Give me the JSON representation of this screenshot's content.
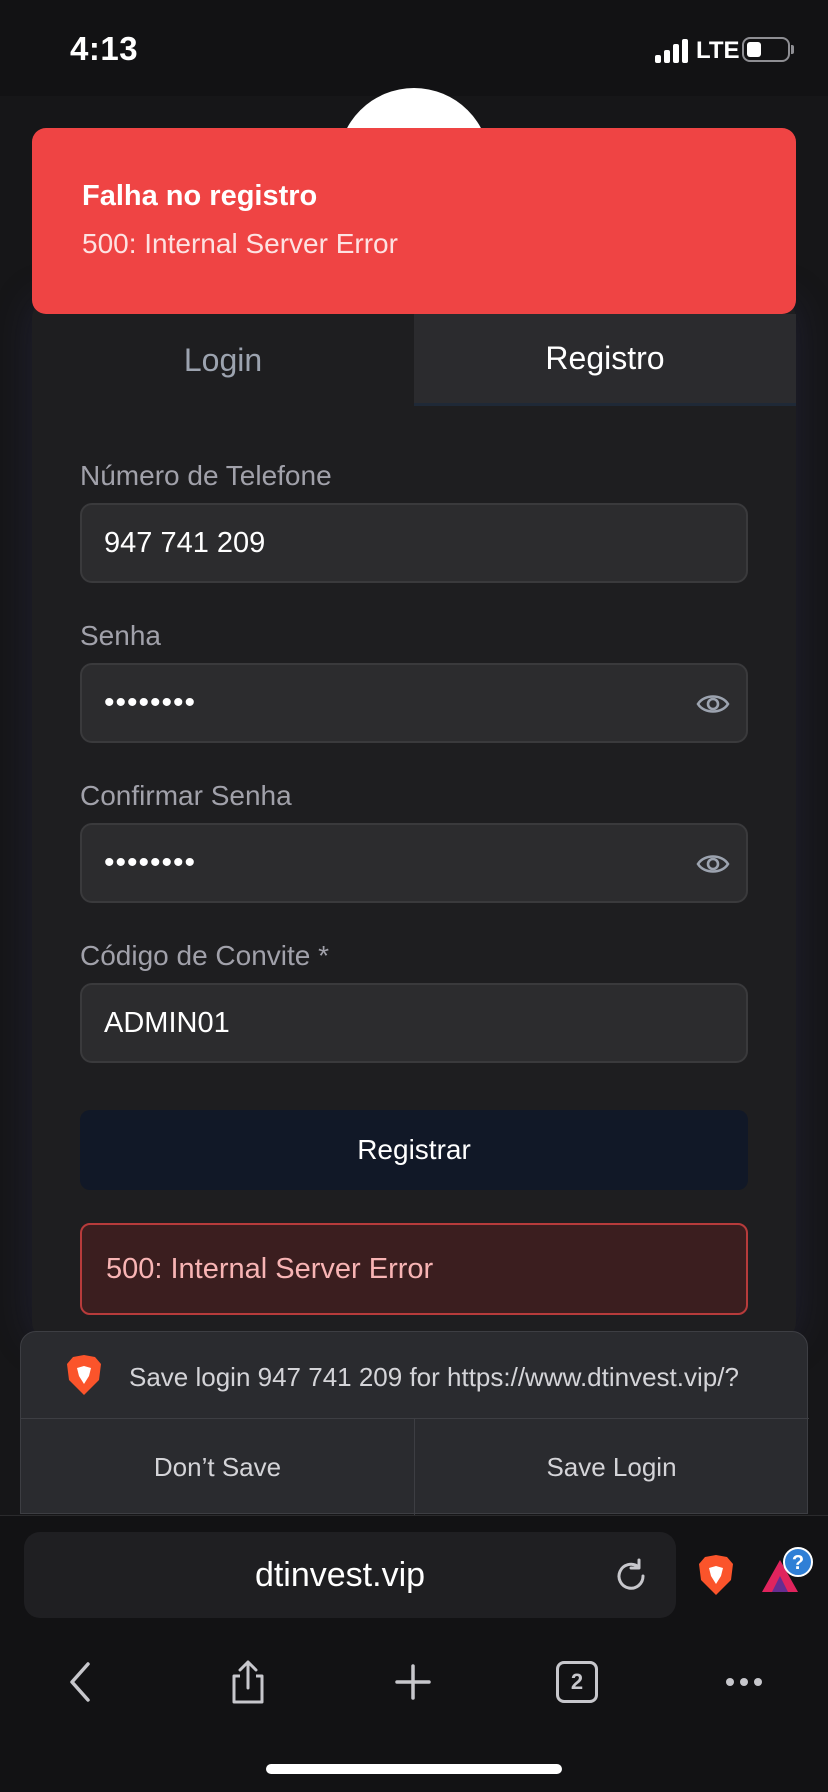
{
  "status_bar": {
    "time": "4:13",
    "network": "LTE"
  },
  "toast": {
    "title": "Falha no registro",
    "message": "500: Internal Server Error"
  },
  "tabs": [
    {
      "label": "Login",
      "active": false
    },
    {
      "label": "Registro",
      "active": true
    }
  ],
  "form": {
    "phone": {
      "label": "Número de Telefone",
      "value": "947 741 209"
    },
    "password": {
      "label": "Senha",
      "value": "••••••••"
    },
    "confirm_password": {
      "label": "Confirmar Senha",
      "value": "••••••••"
    },
    "invite_code": {
      "label": "Código de Convite *",
      "value": "ADMIN01"
    },
    "submit_label": "Registrar",
    "error": "500: Internal Server Error"
  },
  "save_prompt": {
    "message": "Save login 947 741 209 for https://www.dtinvest.vip/?",
    "dont_save": "Don’t Save",
    "save": "Save Login"
  },
  "browser": {
    "url": "dtinvest.vip",
    "tab_count": "2",
    "rewards_badge": "?"
  },
  "colors": {
    "toast_bg": "#ef4444",
    "error_border": "#b73b3b",
    "submit_bg": "#111827",
    "brave_orange": "#fb542b"
  }
}
